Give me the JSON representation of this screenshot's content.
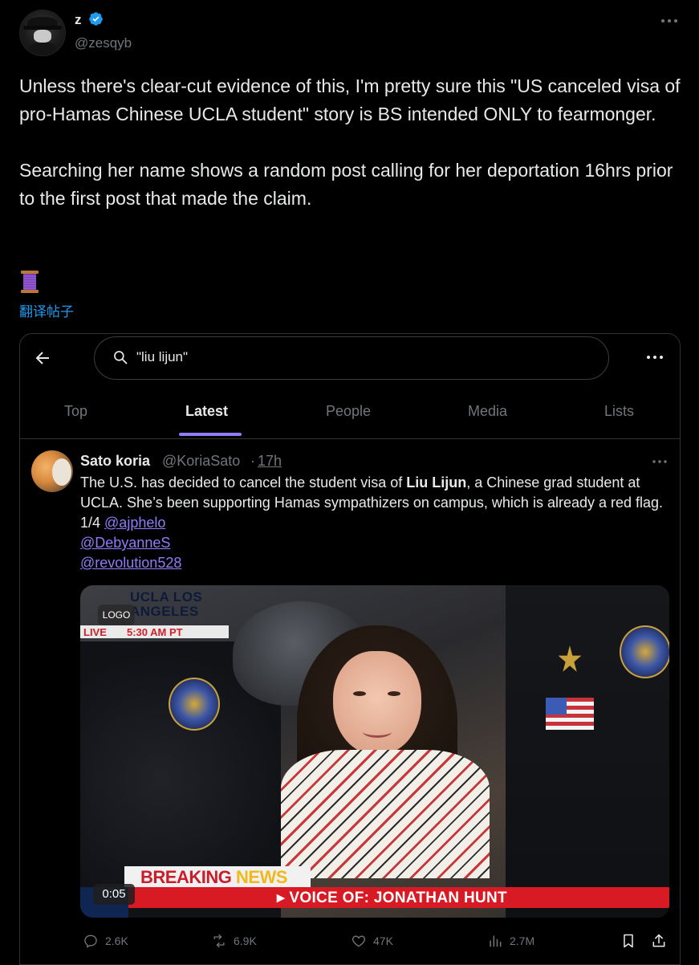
{
  "post": {
    "display_name": "z",
    "handle": "@zesqyb",
    "paragraphs": [
      "Unless there's clear-cut evidence of this, I'm pretty sure this \"US canceled visa of pro-Hamas Chinese UCLA student\" story is BS intended ONLY to fearmonger.",
      "Searching her name shows a random post calling for her deportation 16hrs prior to the first post that made the claim."
    ],
    "thread_icon": "spool-of-thread-icon",
    "translate_label": "翻译帖子"
  },
  "embedded": {
    "search_query": "\"liu lijun\"",
    "tabs": [
      {
        "label": "Top"
      },
      {
        "label": "Latest"
      },
      {
        "label": "People"
      },
      {
        "label": "Media"
      },
      {
        "label": "Lists"
      }
    ],
    "active_tab": "Latest",
    "result": {
      "name": "Sato koria",
      "handle": "@KoriaSato",
      "separator": "·",
      "time": "17h",
      "text_pre": "The U.S. has decided to cancel the student visa of ",
      "text_bold": "Liu Lijun",
      "text_post": ", a Chinese grad student at UCLA. She’s been supporting Hamas sympathizers on campus, which is already a red flag. 1/4 ",
      "mentions": [
        "@ajphelo",
        "@DebyanneS",
        "@revolution528"
      ],
      "video": {
        "overlay_location": "UCLA LOS ANGELES",
        "overlay_live": "LIVE",
        "overlay_time": "5:30 AM PT",
        "ad_badge": "LOGO",
        "breaking_1": "BREAKING",
        "breaking_2": "NEWS",
        "lower_third": "VOICE OF: JONATHAN HUNT",
        "duration": "0:05"
      },
      "stats": {
        "replies": "2.6K",
        "reposts": "6.9K",
        "likes": "47K",
        "views": "2.7M"
      }
    }
  },
  "colors": {
    "background": "#000000",
    "text": "#e7e9ea",
    "muted": "#71767b",
    "link_blue": "#1d9bf0",
    "accent_purple": "#8e7cf8",
    "verified_blue": "#1d9bf0"
  }
}
